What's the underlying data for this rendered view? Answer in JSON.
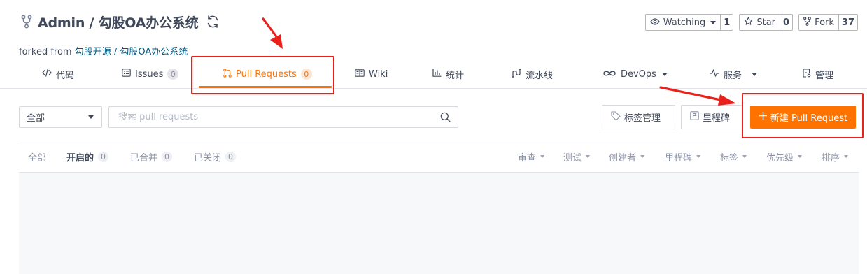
{
  "repo": {
    "title": "Admin / 勾股OA办公系统",
    "forked_prefix": "forked from ",
    "forked_source": "勾股开源 / 勾股OA办公系统"
  },
  "social": {
    "watch_label": "Watching",
    "watch_count": "1",
    "star_label": "Star",
    "star_count": "0",
    "fork_label": "Fork",
    "fork_count": "37"
  },
  "tabs": [
    {
      "label": "代码",
      "icon": "code-icon"
    },
    {
      "label": "Issues",
      "badge": "0",
      "icon": "issues-icon"
    },
    {
      "label": "Pull Requests",
      "badge": "0",
      "icon": "pull-request-icon",
      "active": true
    },
    {
      "label": "Wiki",
      "icon": "wiki-icon"
    },
    {
      "label": "统计",
      "icon": "stats-icon"
    },
    {
      "label": "流水线",
      "icon": "pipeline-icon"
    },
    {
      "label": "DevOps",
      "icon": "infinity-icon"
    },
    {
      "label": "服务",
      "icon": "pulse-icon"
    },
    {
      "label": "管理",
      "icon": "manage-icon"
    }
  ],
  "toolbar": {
    "select_value": "全部",
    "search_placeholder": "搜索 pull requests",
    "label_manage": "标签管理",
    "milestone": "里程碑",
    "new_pr": "新建 Pull Request"
  },
  "states": [
    {
      "label": "全部"
    },
    {
      "label": "开启的",
      "badge": "0",
      "active": true
    },
    {
      "label": "已合并",
      "badge": "0"
    },
    {
      "label": "已关闭",
      "badge": "0"
    }
  ],
  "filters": [
    "审查",
    "测试",
    "创建者",
    "里程碑",
    "标签",
    "优先级",
    "排序"
  ],
  "colors": {
    "accent": "#fe7300",
    "annotation": "#e8211b",
    "text": "#40485b",
    "muted": "#8c92a4"
  }
}
